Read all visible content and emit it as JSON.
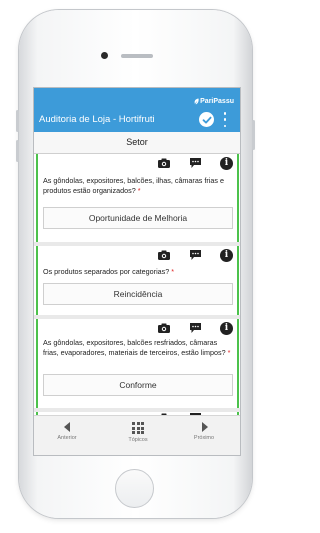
{
  "app": {
    "brand": "PariPassu",
    "title": "Auditoria de Loja - Hortifruti"
  },
  "section": {
    "label": "Setor"
  },
  "questions": [
    {
      "text": "As gôndolas, expositores, balcões, ilhas, câmaras frias e produtos estão organizados?",
      "required": "*",
      "answer": "Oportunidade de Melhoria"
    },
    {
      "text": "Os produtos separados por categorias?",
      "required": "*",
      "answer": "Reincidência"
    },
    {
      "text": "As gôndolas, expositores, balcões resfriados, câmaras frias, evaporadores, materiais de terceiros, estão limpos?",
      "required": "*",
      "answer": "Conforme"
    }
  ],
  "info_glyph": "i",
  "bottom_nav": {
    "prev_label": "Anterior",
    "topics_label": "Tópicos",
    "next_label": "Próximo"
  },
  "colors": {
    "app_bar": "#3d9bd9",
    "answered_border": "#4cc24c",
    "required": "#e02020"
  },
  "icons": [
    "check-circle-icon",
    "more-vertical-icon",
    "camera-icon",
    "comment-icon",
    "info-icon",
    "chevron-left-icon",
    "grid-icon",
    "chevron-right-icon"
  ]
}
